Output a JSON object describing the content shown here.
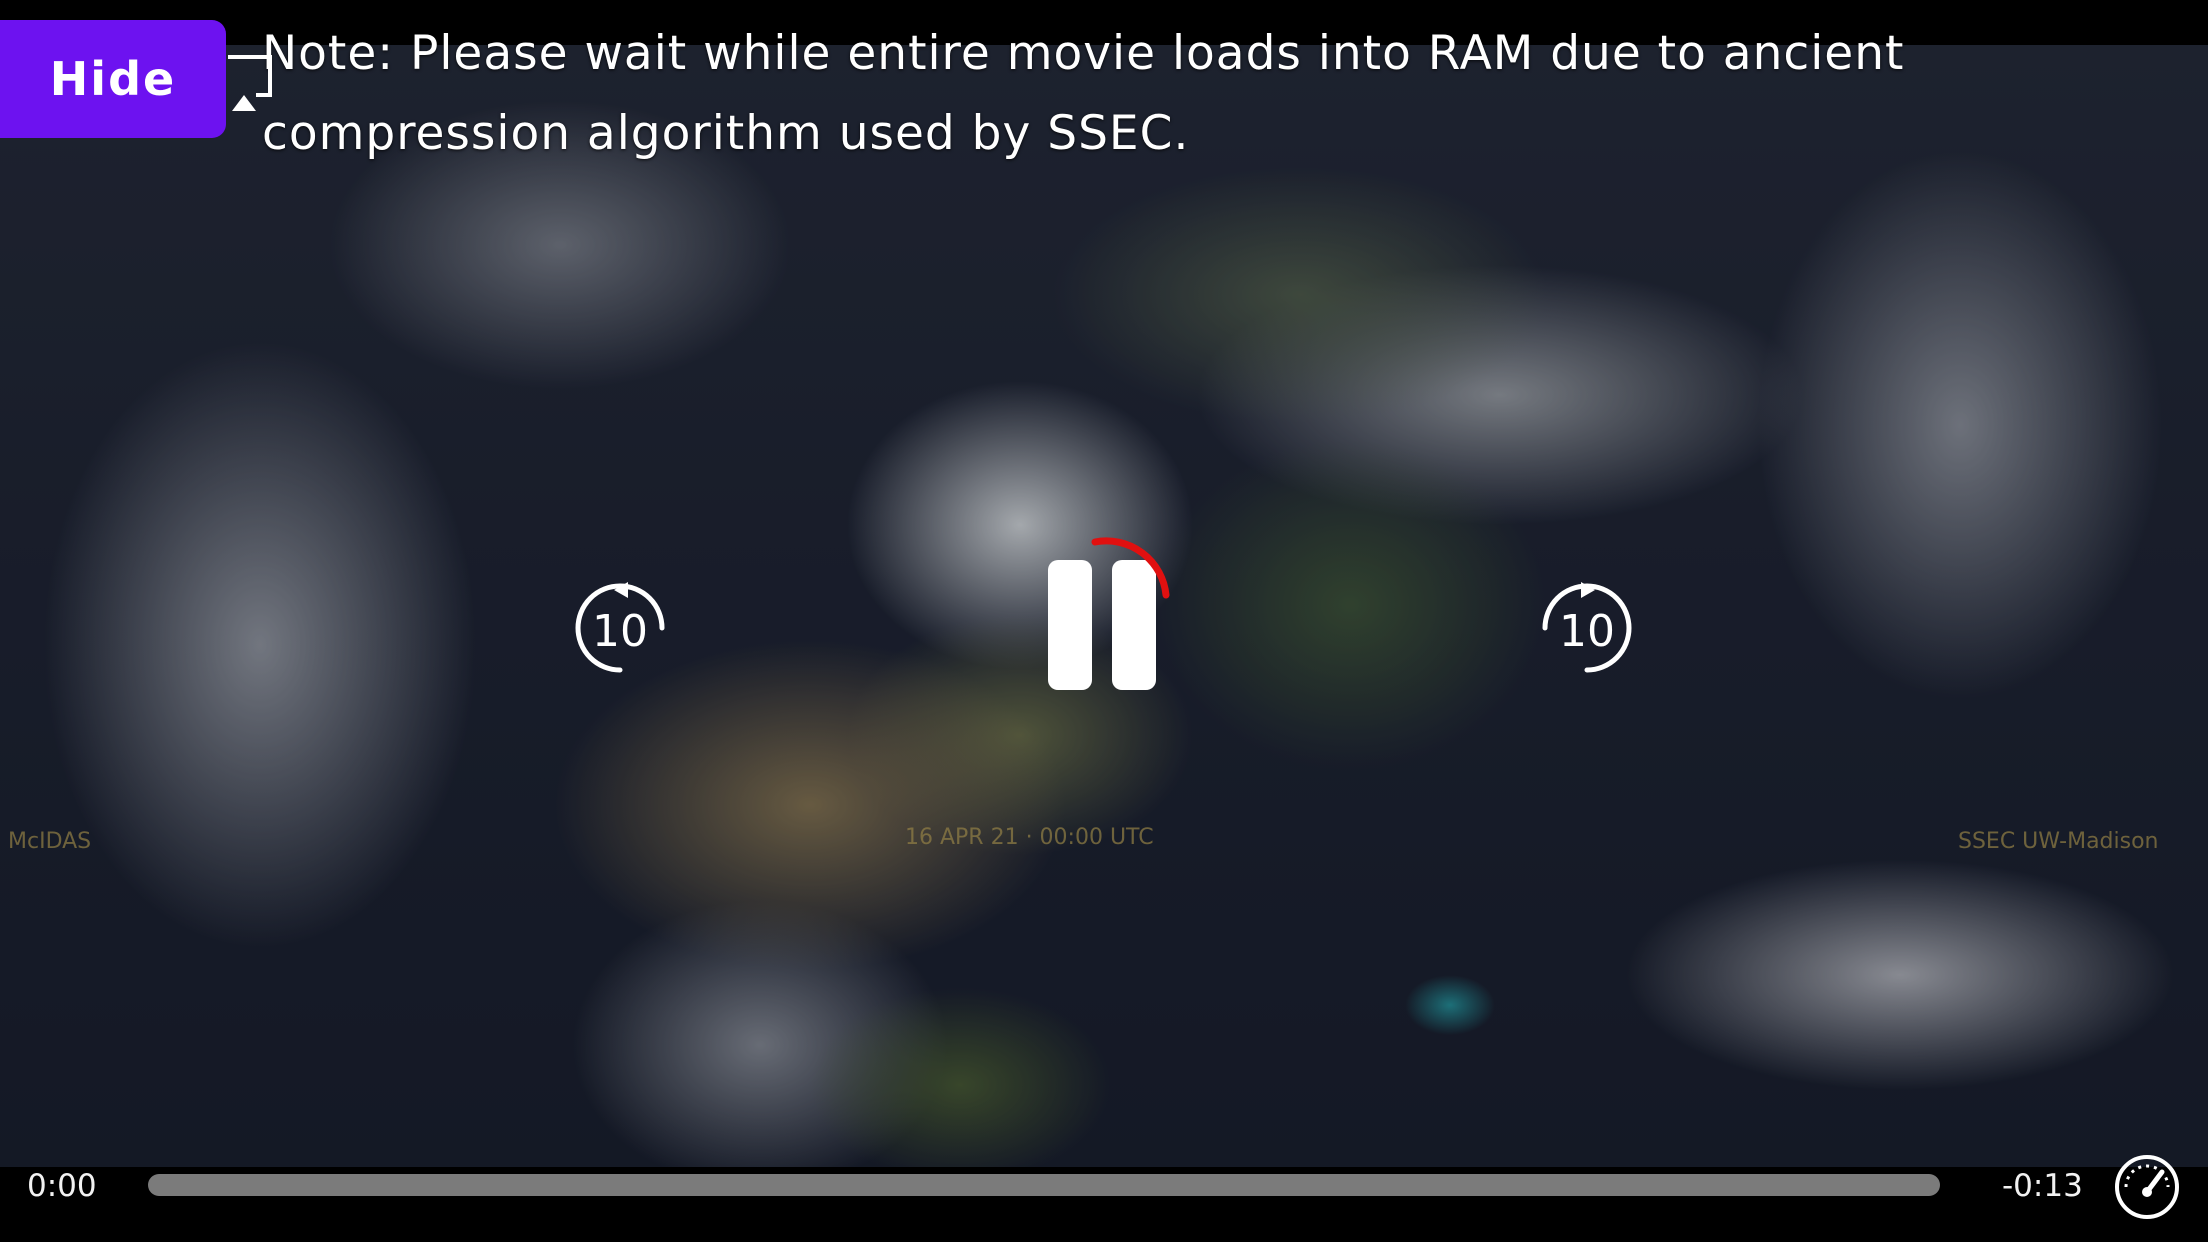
{
  "note": {
    "text": "Note: Please wait while entire movie loads into RAM due to ancient compression algorithm used by SSEC."
  },
  "buttons": {
    "hide_label": "Hide"
  },
  "player": {
    "state": "playing",
    "skip_back": {
      "icon": "skip-back-10-icon",
      "seconds": "10"
    },
    "skip_forward": {
      "icon": "skip-forward-10-icon",
      "seconds": "10"
    },
    "pause_icon": "pause-icon",
    "loading_icon": "loading-ring-icon",
    "time_elapsed": "0:00",
    "time_remaining": "-0:13",
    "progress": 0.0,
    "speed_icon": "playback-speed-icon"
  },
  "colors": {
    "accent": "#6d12f0",
    "loading": "#e01010",
    "scrub_track": "#919191"
  }
}
